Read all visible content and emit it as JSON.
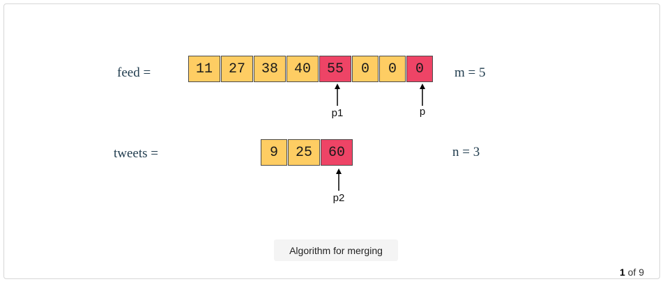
{
  "feed": {
    "label": "feed =",
    "values": [
      "11",
      "27",
      "38",
      "40",
      "55",
      "0",
      "0",
      "0"
    ],
    "highlight": [
      4,
      7
    ],
    "size_label": "m = 5"
  },
  "tweets": {
    "label": "tweets =",
    "values": [
      "9",
      "25",
      "60"
    ],
    "highlight": [
      2
    ],
    "size_label": "n = 3"
  },
  "pointers": {
    "p1": "p1",
    "p": "p",
    "p2": "p2"
  },
  "caption": "Algorithm for merging",
  "pager": {
    "current": "1",
    "of_text": "of 9"
  },
  "colors": {
    "cell_default": "#fecd63",
    "cell_highlight": "#ee4466"
  }
}
